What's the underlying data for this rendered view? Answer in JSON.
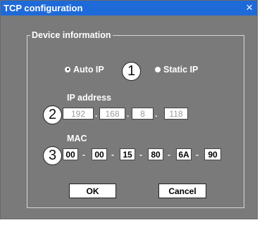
{
  "window": {
    "title": "TCP  configuration",
    "close_glyph": "×"
  },
  "group": {
    "legend": "Device information"
  },
  "mode": {
    "auto_ip_label": "Auto IP",
    "static_ip_label": "Static IP",
    "selected": "Auto IP"
  },
  "callouts": [
    "1",
    "2",
    "3"
  ],
  "ip": {
    "label": "IP address",
    "octets": [
      "192",
      "168",
      "8",
      "118"
    ],
    "separator": "."
  },
  "mac": {
    "label": "MAC",
    "bytes": [
      "00",
      "00",
      "15",
      "80",
      "6A",
      "90"
    ],
    "separator": "-"
  },
  "buttons": {
    "ok_label": "OK",
    "cancel_label": "Cancel"
  },
  "colors": {
    "titlebar": "#1e6ad8",
    "dialog_bg": "#7a7a7a",
    "text": "#ffffff",
    "ip_text": "#9a9a9a"
  },
  "icons": {
    "close": "close-icon",
    "radio": "radio-icon"
  }
}
